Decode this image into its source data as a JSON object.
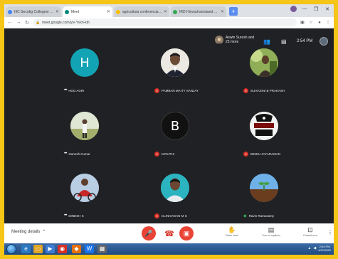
{
  "browser": {
    "tabs": [
      {
        "label": "IIIC Secrdig Collegest Ktiic",
        "favicon_color": "#4285f4",
        "active": false
      },
      {
        "label": "Meet",
        "favicon_color": "#00897b",
        "active": true
      },
      {
        "label": "agricultura conferencia 2022 ini",
        "favicon_color": "#fbbc04",
        "active": false
      },
      {
        "label": "IRD Hinvachamstand Sami",
        "favicon_color": "#34a853",
        "active": false
      }
    ],
    "new_tab_label": "+",
    "address": "meet.google.com/yiv-Yvxn-kih",
    "window_controls": {
      "minimize": "—",
      "maximize": "❐",
      "close": "✕"
    }
  },
  "meet": {
    "presenter_name": "Aswin Suresh and 23 more",
    "time": "2:54 PM",
    "participants": [
      {
        "name": "HOD AGRI",
        "avatar_type": "initial",
        "initial": "H",
        "avatar_color": "#12a4b4",
        "status": "dots"
      },
      {
        "name": "PAMBAN MAITY SANJAY",
        "avatar_type": "photo",
        "avatar_color": "#ece8e2",
        "status": "muted"
      },
      {
        "name": "SUHASINI B PRAKASH",
        "avatar_type": "photo",
        "avatar_color": "#6e8b3d",
        "status": "muted"
      },
      {
        "name": "Ganesh Kumar",
        "avatar_type": "photo",
        "avatar_color": "#b9c3a1",
        "status": "dots"
      },
      {
        "name": "KIRUTHI",
        "avatar_type": "initial",
        "initial": "B",
        "avatar_color": "#111111",
        "status": "muted"
      },
      {
        "name": "BINDU JAYARAMAN",
        "avatar_type": "photo",
        "avatar_color": "#f2f2f2",
        "status": "muted"
      },
      {
        "name": "DINESH S",
        "avatar_type": "photo",
        "avatar_color": "#8aa6c8",
        "status": "dots"
      },
      {
        "name": "CLINIVASAN M S",
        "avatar_type": "photo",
        "avatar_color": "#2bb3c0",
        "status": "muted"
      },
      {
        "name": "Ravin Ramasamy",
        "avatar_type": "photo",
        "avatar_color": "#4c8fcf",
        "status": "speaking"
      }
    ],
    "bottom": {
      "meeting_details_label": "Meeting details",
      "actions": [
        {
          "label": "Raise hand",
          "icon": "hand-icon"
        },
        {
          "label": "Turn on captions",
          "icon": "captions-icon"
        },
        {
          "label": "Present now",
          "icon": "present-icon"
        }
      ]
    }
  },
  "taskbar": {
    "time": "2:54 PM",
    "date": "4/21/2022"
  }
}
